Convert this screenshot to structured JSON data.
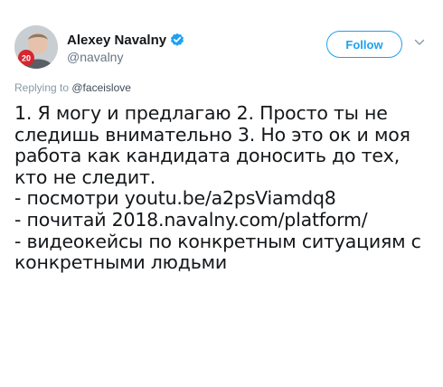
{
  "author": {
    "display_name": "Alexey Navalny",
    "handle": "@navalny",
    "avatar_badge": "20",
    "verified": true
  },
  "actions": {
    "follow_label": "Follow",
    "more_icon": "chevron-down-icon"
  },
  "reply": {
    "prefix": "Replying to ",
    "mention": "@faceislove"
  },
  "tweet": {
    "lines": [
      "1. Я могу и предлагаю 2. Просто ты не",
      "следишь внимательно 3. Но это ок и моя",
      "работа как кандидата доносить до тех,",
      "кто не следит.",
      "- посмотри youtu.be/a2psViamdq8",
      "- почитай 2018.navalny.com/platform/",
      "- видеокейсы по конкретным ситуациям с",
      "конкретными людьми"
    ]
  },
  "colors": {
    "accent": "#1da1f2",
    "text_primary": "#14171a",
    "text_secondary": "#657786",
    "badge_red": "#d7262e"
  }
}
